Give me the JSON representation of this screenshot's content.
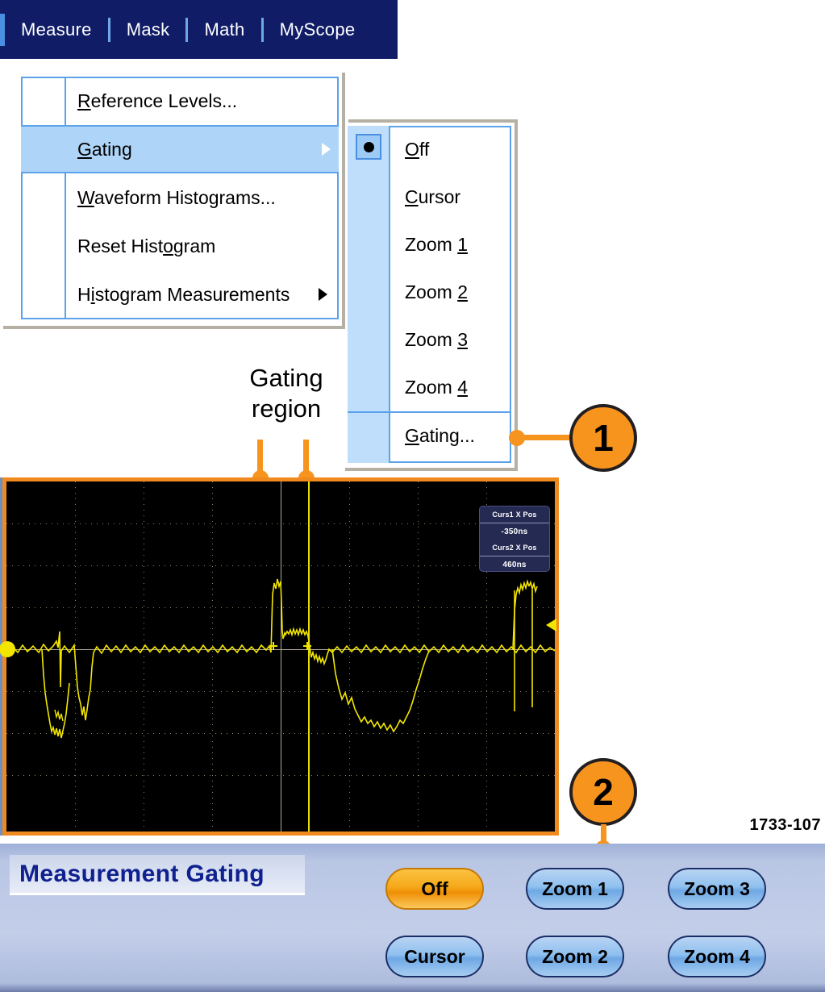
{
  "menubar": {
    "items": [
      {
        "label": "Measure"
      },
      {
        "label": "Mask"
      },
      {
        "label": "Math"
      },
      {
        "label": "MyScope"
      }
    ]
  },
  "dropdown": {
    "items": [
      {
        "label": "Reference Levels...",
        "mnemonic": "R",
        "submenu": false,
        "selected": false
      },
      {
        "label": "Gating",
        "mnemonic": "G",
        "submenu": true,
        "selected": true
      },
      {
        "label": "Waveform Histograms...",
        "mnemonic": "W",
        "submenu": false,
        "selected": false
      },
      {
        "label": "Reset Histogram",
        "mnemonic": "o",
        "submenu": false,
        "selected": false
      },
      {
        "label": "Histogram Measurements",
        "mnemonic": "i",
        "submenu": true,
        "selected": false
      }
    ]
  },
  "submenu": {
    "items": [
      {
        "label": "Off",
        "checked": true
      },
      {
        "label": "Cursor",
        "checked": false
      },
      {
        "label": "Zoom 1",
        "checked": false
      },
      {
        "label": "Zoom 2",
        "checked": false
      },
      {
        "label": "Zoom 3",
        "checked": false
      },
      {
        "label": "Zoom 4",
        "checked": false
      },
      {
        "label": "Gating...",
        "checked": false
      }
    ]
  },
  "annotations": {
    "gating_region_line1": "Gating",
    "gating_region_line2": "region",
    "callout_1": "1",
    "callout_2": "2",
    "figure_id": "1733-107"
  },
  "scope": {
    "readout": {
      "cursor1_label": "Curs1 X Pos",
      "cursor1_value": "-350ns",
      "cursor2_label": "Curs2 X Pos",
      "cursor2_value": "460ns"
    }
  },
  "panel": {
    "title": "Measurement Gating",
    "buttons": [
      {
        "label": "Off",
        "active": true
      },
      {
        "label": "Cursor",
        "active": false
      },
      {
        "label": "Zoom 1",
        "active": false
      },
      {
        "label": "Zoom 2",
        "active": false
      },
      {
        "label": "Zoom 3",
        "active": false
      },
      {
        "label": "Zoom 4",
        "active": false
      }
    ]
  },
  "colors": {
    "menubar_bg": "#101c66",
    "accent_orange": "#f7941e",
    "scope_border": "#f08a1e",
    "waveform": "#f2e600",
    "highlight_blue": "#aed5f7",
    "panel_title": "#10218f"
  }
}
